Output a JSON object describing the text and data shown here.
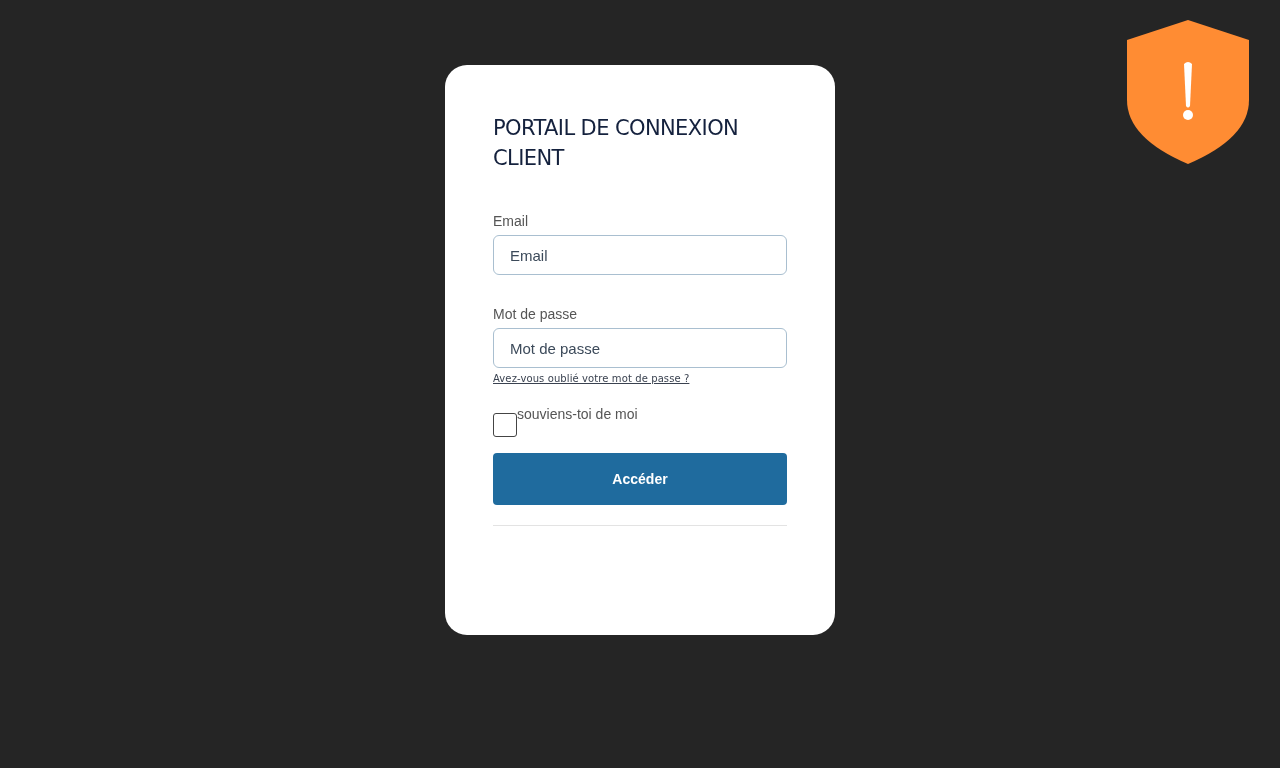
{
  "title": "PORTAIL DE CONNEXION CLIENT",
  "fields": [
    {
      "label": "Email",
      "placeholder": "Email"
    },
    {
      "label": "Mot de passe",
      "placeholder": "Mot de passe"
    }
  ],
  "forgot_link": "Avez-vous oublié votre mot de passe ?",
  "remember": {
    "label": "souviens-toi de moi",
    "checked": false
  },
  "submit": "Accéder",
  "alert_badge": {
    "kind": "warning"
  }
}
